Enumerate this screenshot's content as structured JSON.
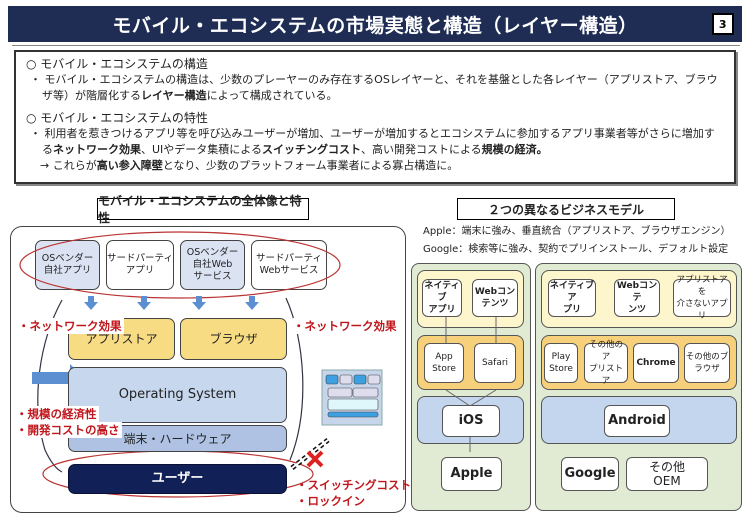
{
  "header": {
    "title": "モバイル・エコシステムの市場実態と構造（レイヤー構造）",
    "page_number": "3"
  },
  "summary": {
    "section1_heading": "○ モバイル・エコシステムの構造",
    "section1_bullet_a": "・ モバイル・エコシステムの構造は、少数のプレーヤーのみ存在するOSレイヤーと、それを基盤とした各レイヤー（アプリストア、ブラウザ等）が階層化する",
    "section1_bullet_bold": "レイヤー構造",
    "section1_bullet_b": "によって構成されている。",
    "section2_heading": "○ モバイル・エコシステムの特性",
    "section2_bullet_a": "・ 利用者を惹きつけるアプリ等を呼び込みユーザーが増加、ユーザーが増加するとエコシステムに参加するアプリ事業者等がさらに増加する",
    "section2_bold1": "ネットワーク効果",
    "section2_mid1": "、UIやデータ集積による",
    "section2_bold2": "スイッチングコスト",
    "section2_mid2": "、高い開発コストによる",
    "section2_bold3": "規模の経済。",
    "section2_arrow_a": "→ これらが",
    "section2_arrow_bold": "高い参入障壁",
    "section2_arrow_b": "となり、少数のプラットフォーム事業者による寡占構造に。"
  },
  "left_diagram": {
    "title": "モバイル・エコシステムの全体像と特性",
    "top_boxes": [
      {
        "line1": "OSベンダー",
        "line2": "自社アプリ",
        "line3": ""
      },
      {
        "line1": "サードパーティ",
        "line2": "アプリ",
        "line3": ""
      },
      {
        "line1": "OSベンダー",
        "line2": "自社Web",
        "line3": "サービス"
      },
      {
        "line1": "サードパーティ",
        "line2": "Webサービス",
        "line3": ""
      }
    ],
    "app_store": "アプリストア",
    "browser": "ブラウザ",
    "os": "Operating System",
    "hardware": "端末・ハードウェア",
    "user": "ユーザー",
    "network_effect_left": "・ネットワーク効果",
    "network_effect_right": "・ネットワーク効果",
    "economies_of_scale": "・規模の経済性",
    "high_dev_cost": "・開発コストの高さ",
    "switching_cost": "・スイッチングコスト",
    "lock_in": "・ロックイン"
  },
  "right_diagram": {
    "title": "２つの異なるビジネスモデル",
    "apple_desc": "Apple：端末に強み、垂直統合（アプリストア、ブラウザエンジン）",
    "google_desc": "Google：検索等に強み、契約でプリインストール、デフォルト設定",
    "apple": {
      "content": [
        {
          "l1": "ネイティブ",
          "l2": "アプリ"
        },
        {
          "l1": "Webコン",
          "l2": "テンツ"
        }
      ],
      "stores": [
        {
          "l1": "App",
          "l2": "Store"
        },
        {
          "l1": "Safari",
          "l2": ""
        }
      ],
      "os": "iOS",
      "maker": "Apple"
    },
    "google": {
      "content": [
        {
          "l1": "ネイティブア",
          "l2": "プリ"
        },
        {
          "l1": "Webコンテ",
          "l2": "ンツ"
        },
        {
          "l1": "アプリストアを",
          "l2": "介さないアプリ"
        }
      ],
      "stores": [
        {
          "l1": "Play",
          "l2": "Store"
        },
        {
          "l1": "その他のア",
          "l2": "プリストア"
        },
        {
          "l1": "Chrome",
          "l2": ""
        },
        {
          "l1": "その他のブ",
          "l2": "ラウザ"
        }
      ],
      "os": "Android",
      "makers": [
        {
          "l1": "Google",
          "l2": ""
        },
        {
          "l1": "その他",
          "l2": "OEM"
        }
      ]
    }
  },
  "colors": {
    "title_bar": "#1f2d55",
    "accent_red": "#c0161c",
    "os_blue": "#c6d7ee",
    "store_yellow": "#f8dc84",
    "user_navy": "#122058",
    "green_panel": "#e1ebd3"
  }
}
